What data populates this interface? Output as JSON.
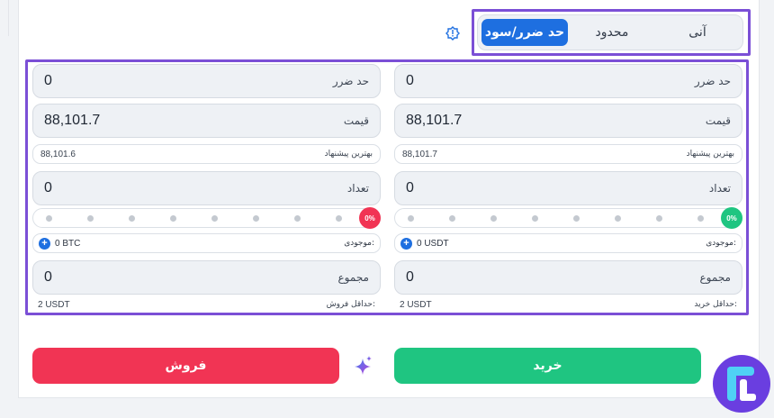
{
  "tabs": [
    {
      "label": "آنی"
    },
    {
      "label": "محدود"
    },
    {
      "label": "حد ضرر/سود"
    }
  ],
  "buy": {
    "stop_loss": {
      "label": "حد ضرر",
      "value": "0"
    },
    "price": {
      "label": "قیمت",
      "value": "88,101.7"
    },
    "best_offer": {
      "label": "بهترین پیشنهاد",
      "value": "88,101.7"
    },
    "amount": {
      "label": "تعداد",
      "value": "0"
    },
    "slider": {
      "percent_label": "0%",
      "percent": 0,
      "knob_color": "#1fc581"
    },
    "balance": {
      "label": "موجودی:",
      "value": "0 USDT"
    },
    "total": {
      "label": "مجموع",
      "value": "0"
    },
    "minimum": {
      "label": "حداقل خرید:",
      "value": "2 USDT"
    },
    "button_label": "خرید"
  },
  "sell": {
    "stop_loss": {
      "label": "حد ضرر",
      "value": "0"
    },
    "price": {
      "label": "قیمت",
      "value": "88,101.7"
    },
    "best_offer": {
      "label": "بهترین پیشنهاد",
      "value": "88,101.6"
    },
    "amount": {
      "label": "تعداد",
      "value": "0"
    },
    "slider": {
      "percent_label": "0%",
      "percent": 0,
      "knob_color": "#f13454"
    },
    "balance": {
      "label": "موجودی:",
      "value": "0 BTC"
    },
    "total": {
      "label": "مجموع",
      "value": "0"
    },
    "minimum": {
      "label": "حداقل فروش:",
      "value": "2 USDT"
    },
    "button_label": "فروش"
  },
  "colors": {
    "accent": "#1e6fe0",
    "buy": "#1fc581",
    "sell": "#f13454",
    "highlight": "#7b4fd6"
  },
  "icons": {
    "info": "info-badge-icon",
    "sparkle": "sparkle-icon",
    "plus": "plus-circle-icon",
    "logo": "brand-logo-icon"
  }
}
